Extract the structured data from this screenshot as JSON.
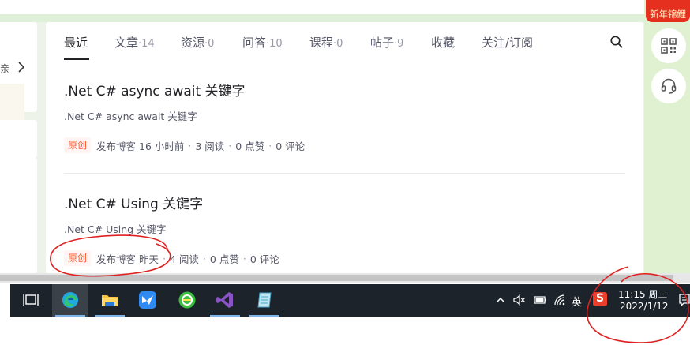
{
  "left_panel": {
    "fragment_text": "亲"
  },
  "tabs": [
    {
      "label": "最近",
      "count": ""
    },
    {
      "label": "文章",
      "count": "14"
    },
    {
      "label": "资源",
      "count": "0"
    },
    {
      "label": "问答",
      "count": "10"
    },
    {
      "label": "课程",
      "count": "0"
    },
    {
      "label": "帖子",
      "count": "9"
    },
    {
      "label": "收藏",
      "count": ""
    },
    {
      "label": "关注/订阅",
      "count": ""
    }
  ],
  "count_separator": "·",
  "posts": [
    {
      "title": ".Net C# async await 关键字",
      "description": ".Net C# async await 关键字",
      "badge": "原创",
      "published": "发布博客 16 小时前",
      "reads": "3 阅读",
      "likes": "0 点赞",
      "comments": "0 评论"
    },
    {
      "title": ".Net C# Using 关键字",
      "description": ".Net C# Using 关键字",
      "badge": "原创",
      "published": "发布博客 昨天",
      "reads": "4 阅读",
      "likes": "0 点赞",
      "comments": "0 评论"
    }
  ],
  "sidebar": {
    "new_year_label": "新年锦鲤"
  },
  "taskbar": {
    "apps": [
      "task-view",
      "edge",
      "file-explorer",
      "feishu",
      "360-browser",
      "visual-studio",
      "notepad"
    ],
    "tray": {
      "ime": "英",
      "sogou": "S"
    },
    "clock": {
      "time": "11:15 周三",
      "date": "2022/1/12"
    }
  },
  "colors": {
    "accent_badge": "#fc5531",
    "sidebar_green": "#e0f1d2",
    "taskbar": "#1c232b",
    "annotation": "#e02020"
  }
}
